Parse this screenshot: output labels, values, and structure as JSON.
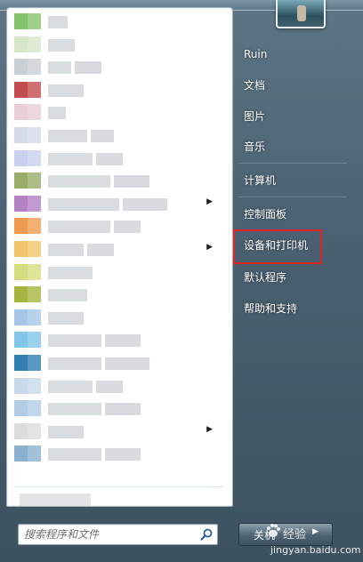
{
  "start_menu": {
    "programs": [
      {
        "icon_color": "#86c46b",
        "has_submenu": false
      },
      {
        "icon_color": "#d7e6c9",
        "has_submenu": false
      },
      {
        "icon_color": "#c9cfd3",
        "has_submenu": false
      },
      {
        "icon_color": "#c24b4e",
        "has_submenu": false
      },
      {
        "icon_color": "#e8cfd4",
        "has_submenu": false
      },
      {
        "icon_color": "#d4dbe9",
        "has_submenu": false
      },
      {
        "icon_color": "#c8d0ee",
        "has_submenu": false
      },
      {
        "icon_color": "#9aab6a",
        "has_submenu": false
      },
      {
        "icon_color": "#b481c4",
        "has_submenu": true
      },
      {
        "icon_color": "#f09a4f",
        "has_submenu": false
      },
      {
        "icon_color": "#f0c56a",
        "has_submenu": true
      },
      {
        "icon_color": "#d5de7e",
        "has_submenu": false
      },
      {
        "icon_color": "#a5b63e",
        "has_submenu": false
      },
      {
        "icon_color": "#a6c6e8",
        "has_submenu": false
      },
      {
        "icon_color": "#7fc6e8",
        "has_submenu": false
      },
      {
        "icon_color": "#2f7fb0",
        "has_submenu": false
      },
      {
        "icon_color": "#c7d9ea",
        "has_submenu": false
      },
      {
        "icon_color": "#b1cce5",
        "has_submenu": false
      },
      {
        "icon_color": "#dcdcdc",
        "has_submenu": true
      },
      {
        "icon_color": "#8ab0d0",
        "has_submenu": false
      }
    ],
    "search": {
      "placeholder": "搜索程序和文件"
    },
    "right_items": [
      {
        "label": "Ruin"
      },
      {
        "label": "文档"
      },
      {
        "label": "图片"
      },
      {
        "label": "音乐"
      },
      {
        "label": "计算机"
      },
      {
        "label": "控制面板"
      },
      {
        "label": "设备和打印机"
      },
      {
        "label": "默认程序"
      },
      {
        "label": "帮助和支持"
      }
    ],
    "shutdown": {
      "label": "关机"
    }
  },
  "watermark": {
    "text": "经验",
    "url": "jingyan.baidu.com"
  },
  "colors": {
    "highlight": "#e02424",
    "menu_text": "#ffffff",
    "panel_bg": "#ffffff"
  }
}
